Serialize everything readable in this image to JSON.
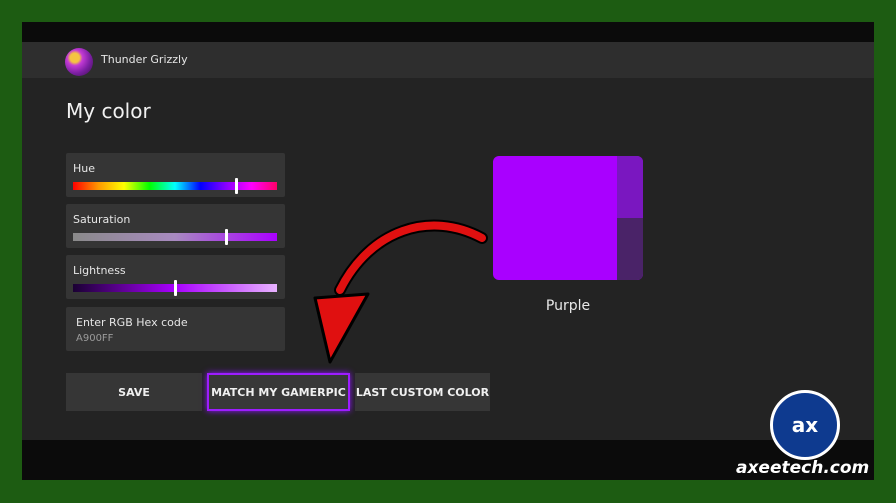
{
  "profile": {
    "gamertag": "Thunder Grizzly"
  },
  "page": {
    "title": "My color"
  },
  "sliders": {
    "hue": {
      "label": "Hue",
      "value": 0.79
    },
    "saturation": {
      "label": "Saturation",
      "value": 0.75
    },
    "lightness": {
      "label": "Lightness",
      "value": 0.5
    }
  },
  "hex": {
    "label": "Enter RGB Hex code",
    "value": "A900FF"
  },
  "preview": {
    "color_name": "Purple",
    "color": "#a900ff"
  },
  "buttons": {
    "save": "SAVE",
    "match": "MATCH MY GAMERPIC",
    "last": "LAST CUSTOM COLOR"
  },
  "overlay": {
    "logo_text": "ax",
    "site": "axeetech.com"
  }
}
